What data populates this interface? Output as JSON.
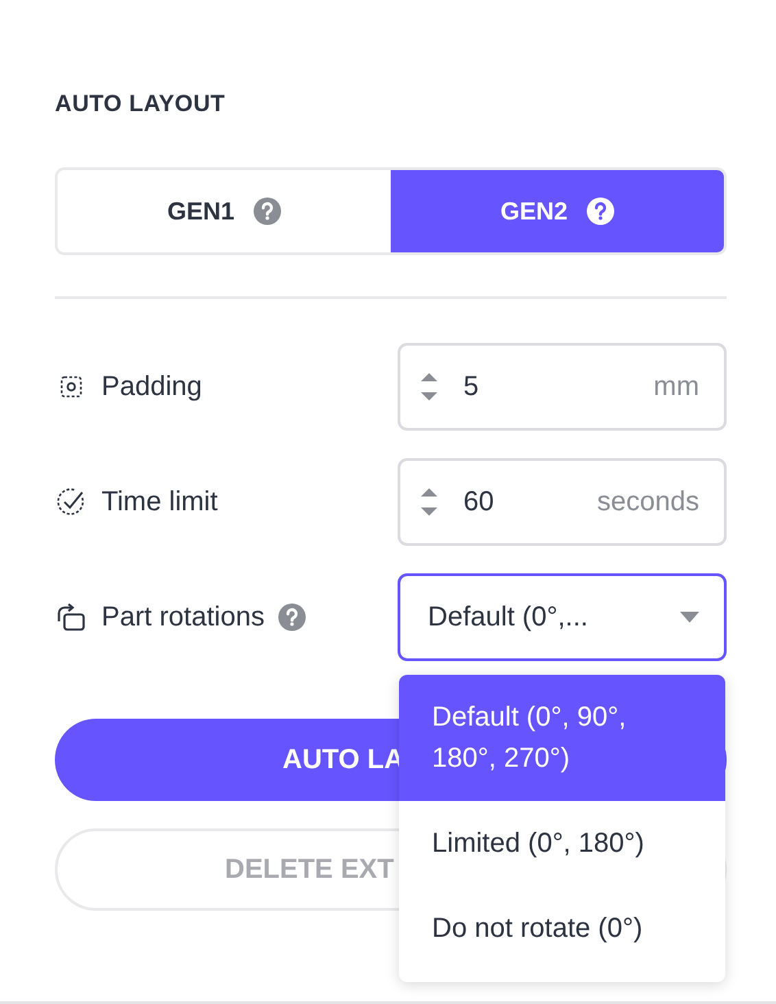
{
  "section": {
    "title": "AUTO LAYOUT"
  },
  "tabs": [
    {
      "label": "GEN1",
      "selected": false
    },
    {
      "label": "GEN2",
      "selected": true
    }
  ],
  "settings": [
    {
      "kind": "number",
      "label": "Padding",
      "value": "5",
      "unit": "mm"
    },
    {
      "kind": "number",
      "label": "Time limit",
      "value": "60",
      "unit": "seconds"
    },
    {
      "kind": "select",
      "label": "Part rotations",
      "help": true,
      "value": "Default (0°,...",
      "open": true
    }
  ],
  "dropdown_options": [
    {
      "label": "Default (0°, 90°, 180°, 270°)",
      "selected": true
    },
    {
      "label": "Limited (0°, 180°)",
      "selected": false
    },
    {
      "label": "Do not rotate (0°)",
      "selected": false
    }
  ],
  "buttons": [
    {
      "label": "AUTO LA",
      "primary": true,
      "disabled": false
    },
    {
      "label": "DELETE EXT",
      "primary": false,
      "disabled": true
    }
  ]
}
